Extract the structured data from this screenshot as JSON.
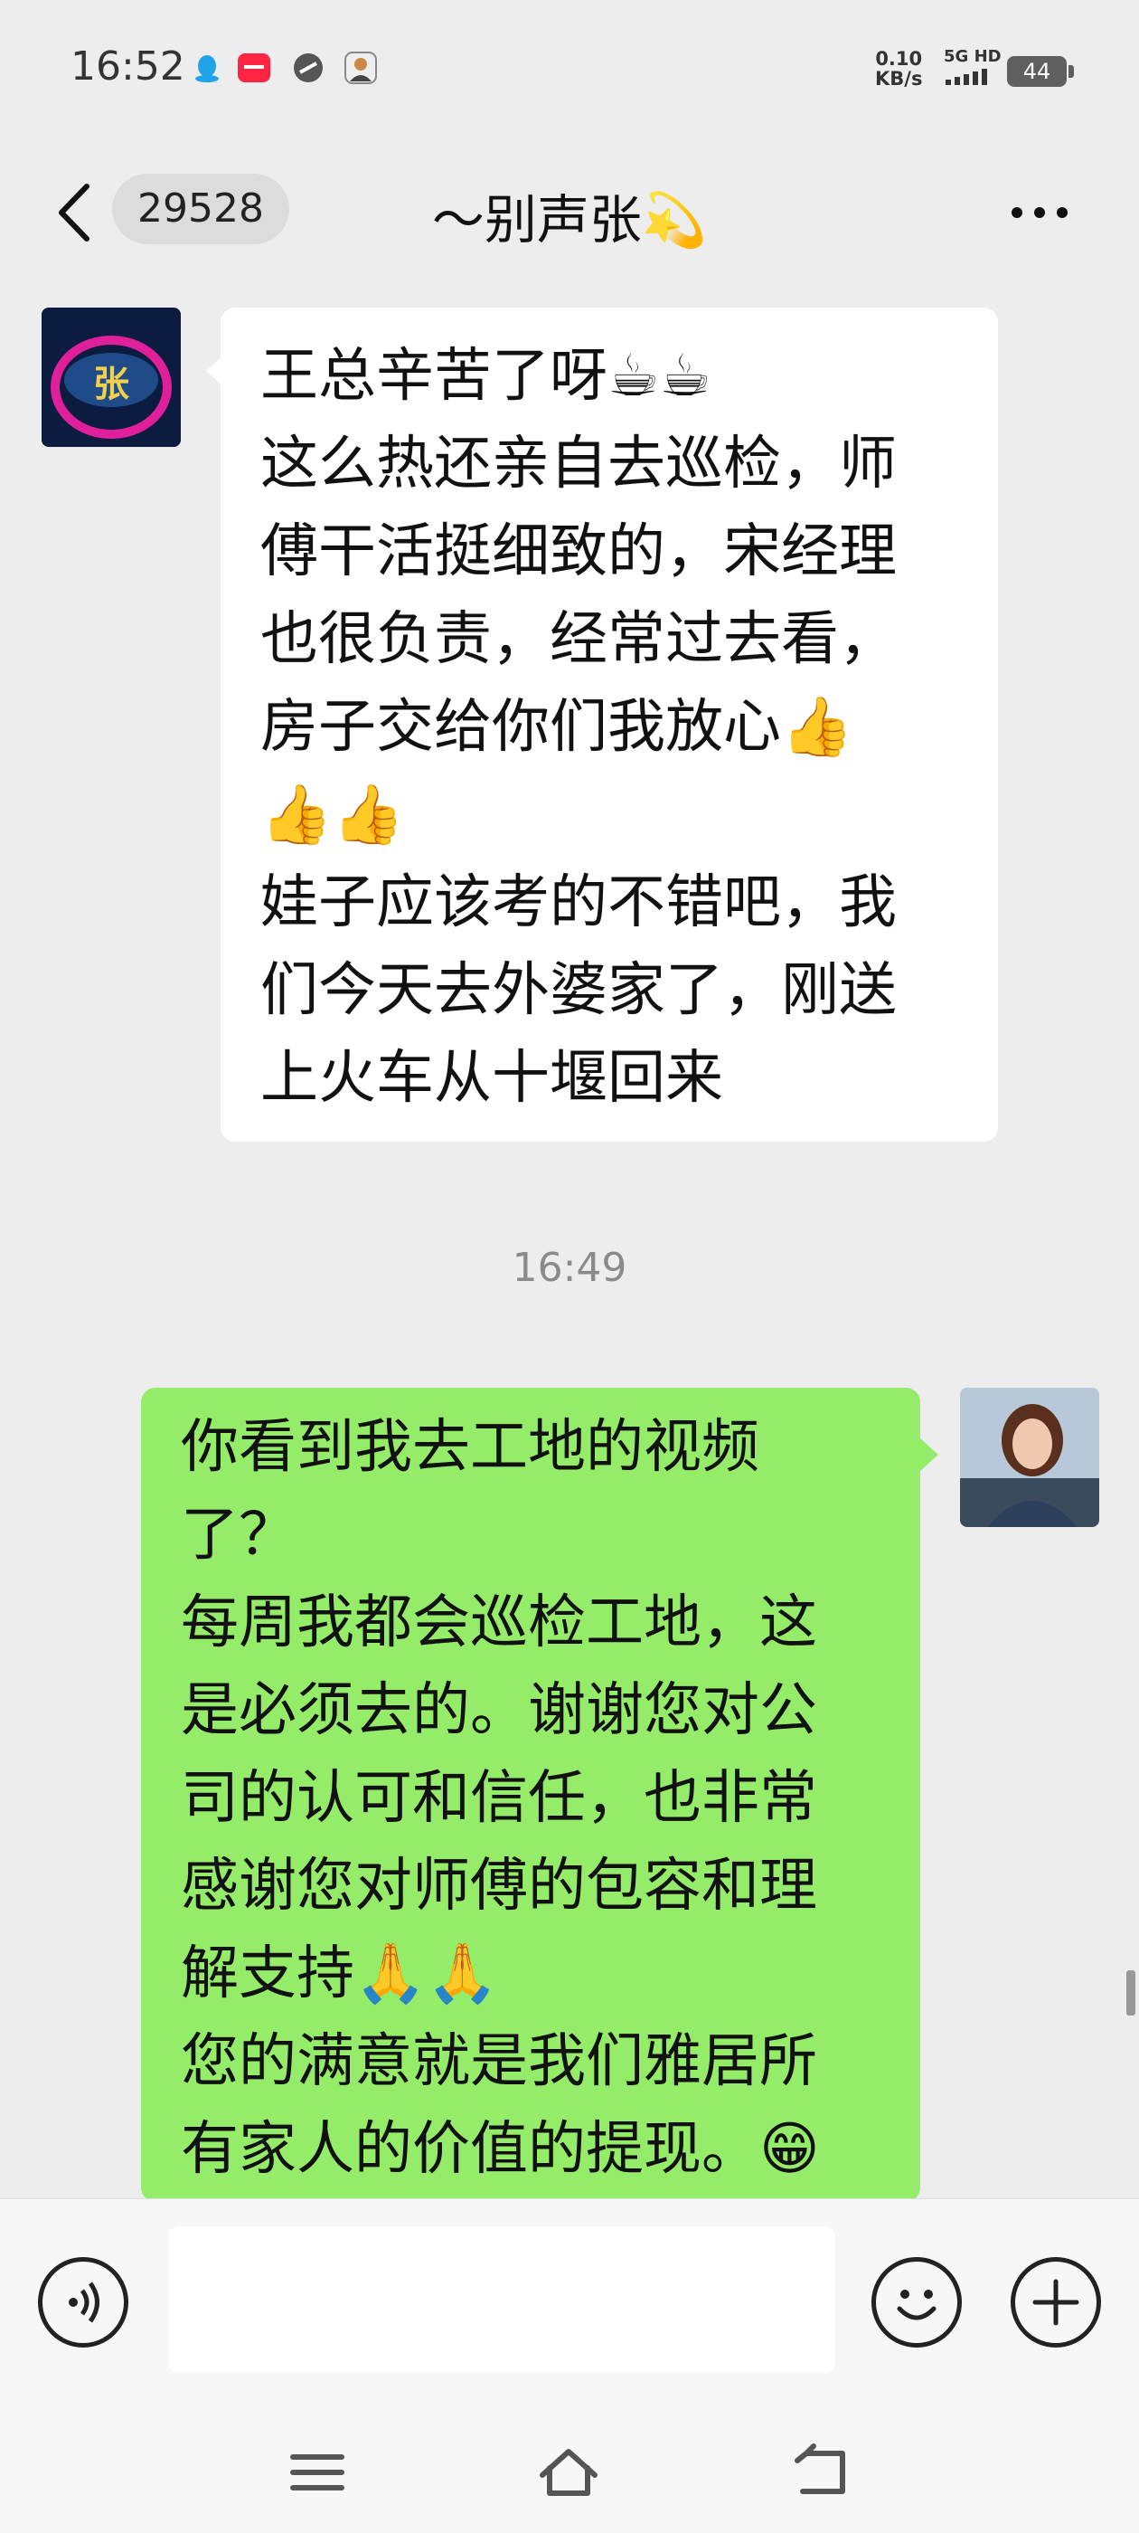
{
  "status_bar": {
    "time": "16:52",
    "net_speed_value": "0.10",
    "net_speed_unit": "KB/s",
    "signal_label": "5G HD",
    "battery": "44"
  },
  "header": {
    "unread_count": "29528",
    "title": "～别声张💫"
  },
  "messages": [
    {
      "direction": "incoming",
      "lines": [
        "王总辛苦了呀☕☕",
        "这么热还亲自去巡检，师",
        "傅干活挺细致的，宋经理",
        "也很负责，经常过去看，",
        "房子交给你们我放心👍",
        "👍👍",
        "娃子应该考的不错吧，我",
        "们今天去外婆家了，刚送",
        "上火车从十堰回来"
      ]
    },
    {
      "direction": "outgoing",
      "lines": [
        "你看到我去工地的视频",
        "了？",
        "每周我都会巡检工地，这",
        "是必须去的。谢谢您对公",
        "司的认可和信任，也非常",
        "感谢您对师傅的包容和理",
        "解支持🙏🙏",
        "您的满意就是我们雅居所",
        "有家人的价值的提现。😁"
      ]
    }
  ],
  "timestamp": "16:49",
  "avatar_text": "张",
  "icons": {
    "status": [
      "qq-icon",
      "xiaohongshu-icon",
      "link-icon",
      "profile-icon"
    ],
    "header": [
      "back-icon",
      "more-icon"
    ],
    "input": [
      "voice-icon",
      "emoji-icon",
      "plus-icon"
    ],
    "nav": [
      "menu-icon",
      "home-icon",
      "back-nav-icon"
    ]
  },
  "colors": {
    "background": "#ededed",
    "incoming_bubble": "#ffffff",
    "outgoing_bubble": "#95ec69"
  }
}
